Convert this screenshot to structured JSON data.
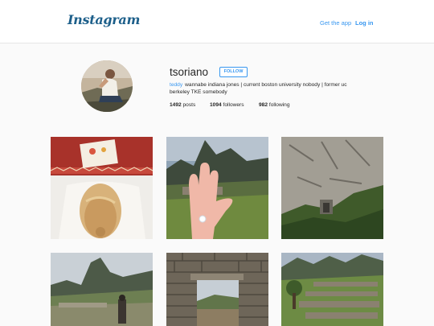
{
  "header": {
    "logo": "Instagram",
    "get_app_label": "Get the app",
    "login_label": "Log in"
  },
  "profile": {
    "username": "tsoriano",
    "follow_label": "FOLLOW",
    "full_name": "teddy",
    "bio": "wannabe indiana jones | current boston university nobody | former uc berkeley TKE somebody",
    "stats": {
      "posts_count": "1492",
      "posts_label": "posts",
      "followers_count": "1094",
      "followers_label": "followers",
      "following_count": "982",
      "following_label": "following"
    }
  },
  "colors": {
    "accent": "#3897f0",
    "background": "#fafafa",
    "text": "#262626"
  },
  "posts": [
    {
      "thumbnail_subject": "woman-lying-on-patterned-blanket"
    },
    {
      "thumbnail_subject": "engagement-ring-hand-machu-picchu"
    },
    {
      "thumbnail_subject": "inca-cliff-wall"
    },
    {
      "thumbnail_subject": "machu-picchu-panorama"
    },
    {
      "thumbnail_subject": "inca-stone-doorway"
    },
    {
      "thumbnail_subject": "inca-ruins-terraces"
    }
  ]
}
